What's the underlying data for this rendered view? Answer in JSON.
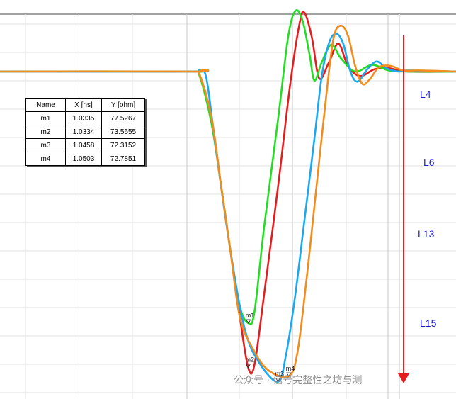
{
  "chart_data": {
    "type": "line",
    "title": "",
    "xlabel": "",
    "ylabel": "",
    "grid": true,
    "marker_table": {
      "headers": [
        "Name",
        "X [ns]",
        "Y [ohm]"
      ],
      "rows": [
        [
          "m1",
          "1.0335",
          "77.5267"
        ],
        [
          "m2",
          "1.0334",
          "73.5655"
        ],
        [
          "m3",
          "1.0458",
          "72.3152"
        ],
        [
          "m4",
          "1.0503",
          "72.7851"
        ]
      ]
    },
    "markers": [
      {
        "name": "m1",
        "x": 1.0335,
        "y": 77.5267,
        "color": "#22dd22"
      },
      {
        "name": "m2",
        "x": 1.0334,
        "y": 73.5655,
        "color": "#e41e1e"
      },
      {
        "name": "m3",
        "x": 1.0458,
        "y": 72.3152,
        "color": "#1aa8f0"
      },
      {
        "name": "m4",
        "x": 1.0503,
        "y": 72.7851,
        "color": "#f28c1c"
      }
    ],
    "series": [
      {
        "color": "#e41e1e",
        "points": [
          [
            0.93,
            100
          ],
          [
            1.01,
            100
          ],
          [
            1.013,
            99.8
          ],
          [
            1.018,
            96
          ],
          [
            1.022,
            90
          ],
          [
            1.026,
            84
          ],
          [
            1.03,
            78
          ],
          [
            1.0334,
            73.57
          ],
          [
            1.036,
            73.8
          ],
          [
            1.04,
            80
          ],
          [
            1.046,
            90
          ],
          [
            1.051,
            99
          ],
          [
            1.055,
            104.5
          ],
          [
            1.057,
            105.2
          ],
          [
            1.06,
            103
          ],
          [
            1.063,
            99.4
          ],
          [
            1.067,
            100.8
          ],
          [
            1.071,
            102.5
          ],
          [
            1.075,
            100.5
          ],
          [
            1.08,
            99.6
          ],
          [
            1.086,
            100.2
          ],
          [
            1.092,
            100.3
          ],
          [
            1.1,
            100
          ],
          [
            1.12,
            100
          ]
        ]
      },
      {
        "color": "#22dd22",
        "points": [
          [
            0.93,
            100
          ],
          [
            1.01,
            100
          ],
          [
            1.013,
            99.7
          ],
          [
            1.018,
            95.5
          ],
          [
            1.022,
            90
          ],
          [
            1.026,
            84
          ],
          [
            1.03,
            79
          ],
          [
            1.0335,
            77.53
          ],
          [
            1.036,
            78.5
          ],
          [
            1.04,
            86
          ],
          [
            1.046,
            96
          ],
          [
            1.05,
            103
          ],
          [
            1.053,
            105.4
          ],
          [
            1.056,
            104.6
          ],
          [
            1.059,
            101.5
          ],
          [
            1.061,
            99.2
          ],
          [
            1.064,
            100.8
          ],
          [
            1.068,
            102.4
          ],
          [
            1.072,
            101.2
          ],
          [
            1.078,
            100
          ],
          [
            1.085,
            100.6
          ],
          [
            1.092,
            100.1
          ],
          [
            1.1,
            100
          ],
          [
            1.12,
            100
          ]
        ]
      },
      {
        "color": "#1aa8f0",
        "points": [
          [
            0.93,
            100
          ],
          [
            1.01,
            100
          ],
          [
            1.013,
            100.1
          ],
          [
            1.016,
            99.4
          ],
          [
            1.02,
            93
          ],
          [
            1.026,
            84
          ],
          [
            1.032,
            77
          ],
          [
            1.038,
            74
          ],
          [
            1.0458,
            72.3
          ],
          [
            1.049,
            74.5
          ],
          [
            1.053,
            80
          ],
          [
            1.057,
            87
          ],
          [
            1.061,
            94
          ],
          [
            1.064,
            99.5
          ],
          [
            1.067,
            102.5
          ],
          [
            1.07,
            103.4
          ],
          [
            1.073,
            102.5
          ],
          [
            1.076,
            100
          ],
          [
            1.079,
            99.1
          ],
          [
            1.083,
            100.2
          ],
          [
            1.087,
            100.9
          ],
          [
            1.091,
            100.3
          ],
          [
            1.096,
            100
          ],
          [
            1.1,
            100.1
          ],
          [
            1.12,
            100
          ]
        ]
      },
      {
        "color": "#f28c1c",
        "points": [
          [
            0.93,
            100
          ],
          [
            1.01,
            100
          ],
          [
            1.013,
            99.8
          ],
          [
            1.018,
            96
          ],
          [
            1.022,
            90
          ],
          [
            1.026,
            84
          ],
          [
            1.03,
            78
          ],
          [
            1.036,
            75
          ],
          [
            1.042,
            73.3
          ],
          [
            1.0503,
            72.79
          ],
          [
            1.054,
            75
          ],
          [
            1.058,
            82
          ],
          [
            1.062,
            90
          ],
          [
            1.066,
            98
          ],
          [
            1.069,
            103
          ],
          [
            1.072,
            104.1
          ],
          [
            1.075,
            103.2
          ],
          [
            1.078,
            100.5
          ],
          [
            1.081,
            98.9
          ],
          [
            1.084,
            99.3
          ],
          [
            1.088,
            100.4
          ],
          [
            1.093,
            100.5
          ],
          [
            1.098,
            100.1
          ],
          [
            1.105,
            100.1
          ],
          [
            1.12,
            100
          ]
        ]
      }
    ],
    "layer_labels": [
      "L4",
      "L6",
      "L13",
      "L15"
    ],
    "arrow_color": "#e41e1e"
  },
  "watermark": "公众号 · 信号完整性之坊与测"
}
